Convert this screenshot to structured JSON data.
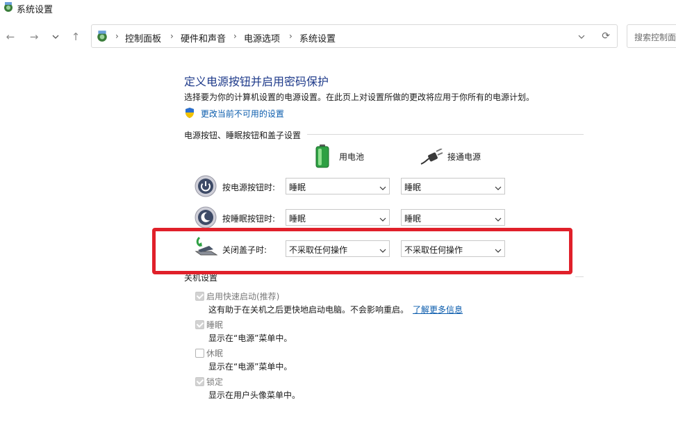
{
  "window": {
    "title": "系统设置"
  },
  "nav": {
    "breadcrumbs": [
      "控制面板",
      "硬件和声音",
      "电源选项",
      "系统设置"
    ],
    "search_placeholder": "搜索控制面"
  },
  "page": {
    "title": "定义电源按钮并启用密码保护",
    "description": "选择要为你的计算机设置的电源设置。在此页上对设置所做的更改将应用于你所有的电源计划。",
    "admin_link": "更改当前不可用的设置"
  },
  "power_group": {
    "title": "电源按钮、睡眠按钮和盖子设置",
    "col_battery": "用电池",
    "col_plugged": "接通电源",
    "rows": [
      {
        "label": "按电源按钮时:",
        "battery": "睡眠",
        "plugged": "睡眠"
      },
      {
        "label": "按睡眠按钮时:",
        "battery": "睡眠",
        "plugged": "睡眠"
      },
      {
        "label": "关闭盖子时:",
        "battery": "不采取任何操作",
        "plugged": "不采取任何操作"
      }
    ]
  },
  "shutdown_group": {
    "title": "关机设置",
    "items": [
      {
        "label": "启用快速启动(推荐)",
        "checked": true,
        "desc": "这有助于在关机之后更快地启动电脑。不会影响重启。",
        "link": "了解更多信息"
      },
      {
        "label": "睡眠",
        "checked": true,
        "desc": "显示在“电源”菜单中。"
      },
      {
        "label": "休眠",
        "checked": false,
        "desc": "显示在“电源”菜单中。"
      },
      {
        "label": "锁定",
        "checked": true,
        "desc": "显示在用户头像菜单中。"
      }
    ]
  },
  "colors": {
    "title_blue": "#1e3a8a",
    "link_blue": "#0b5cad",
    "highlight_red": "#e0202a"
  }
}
